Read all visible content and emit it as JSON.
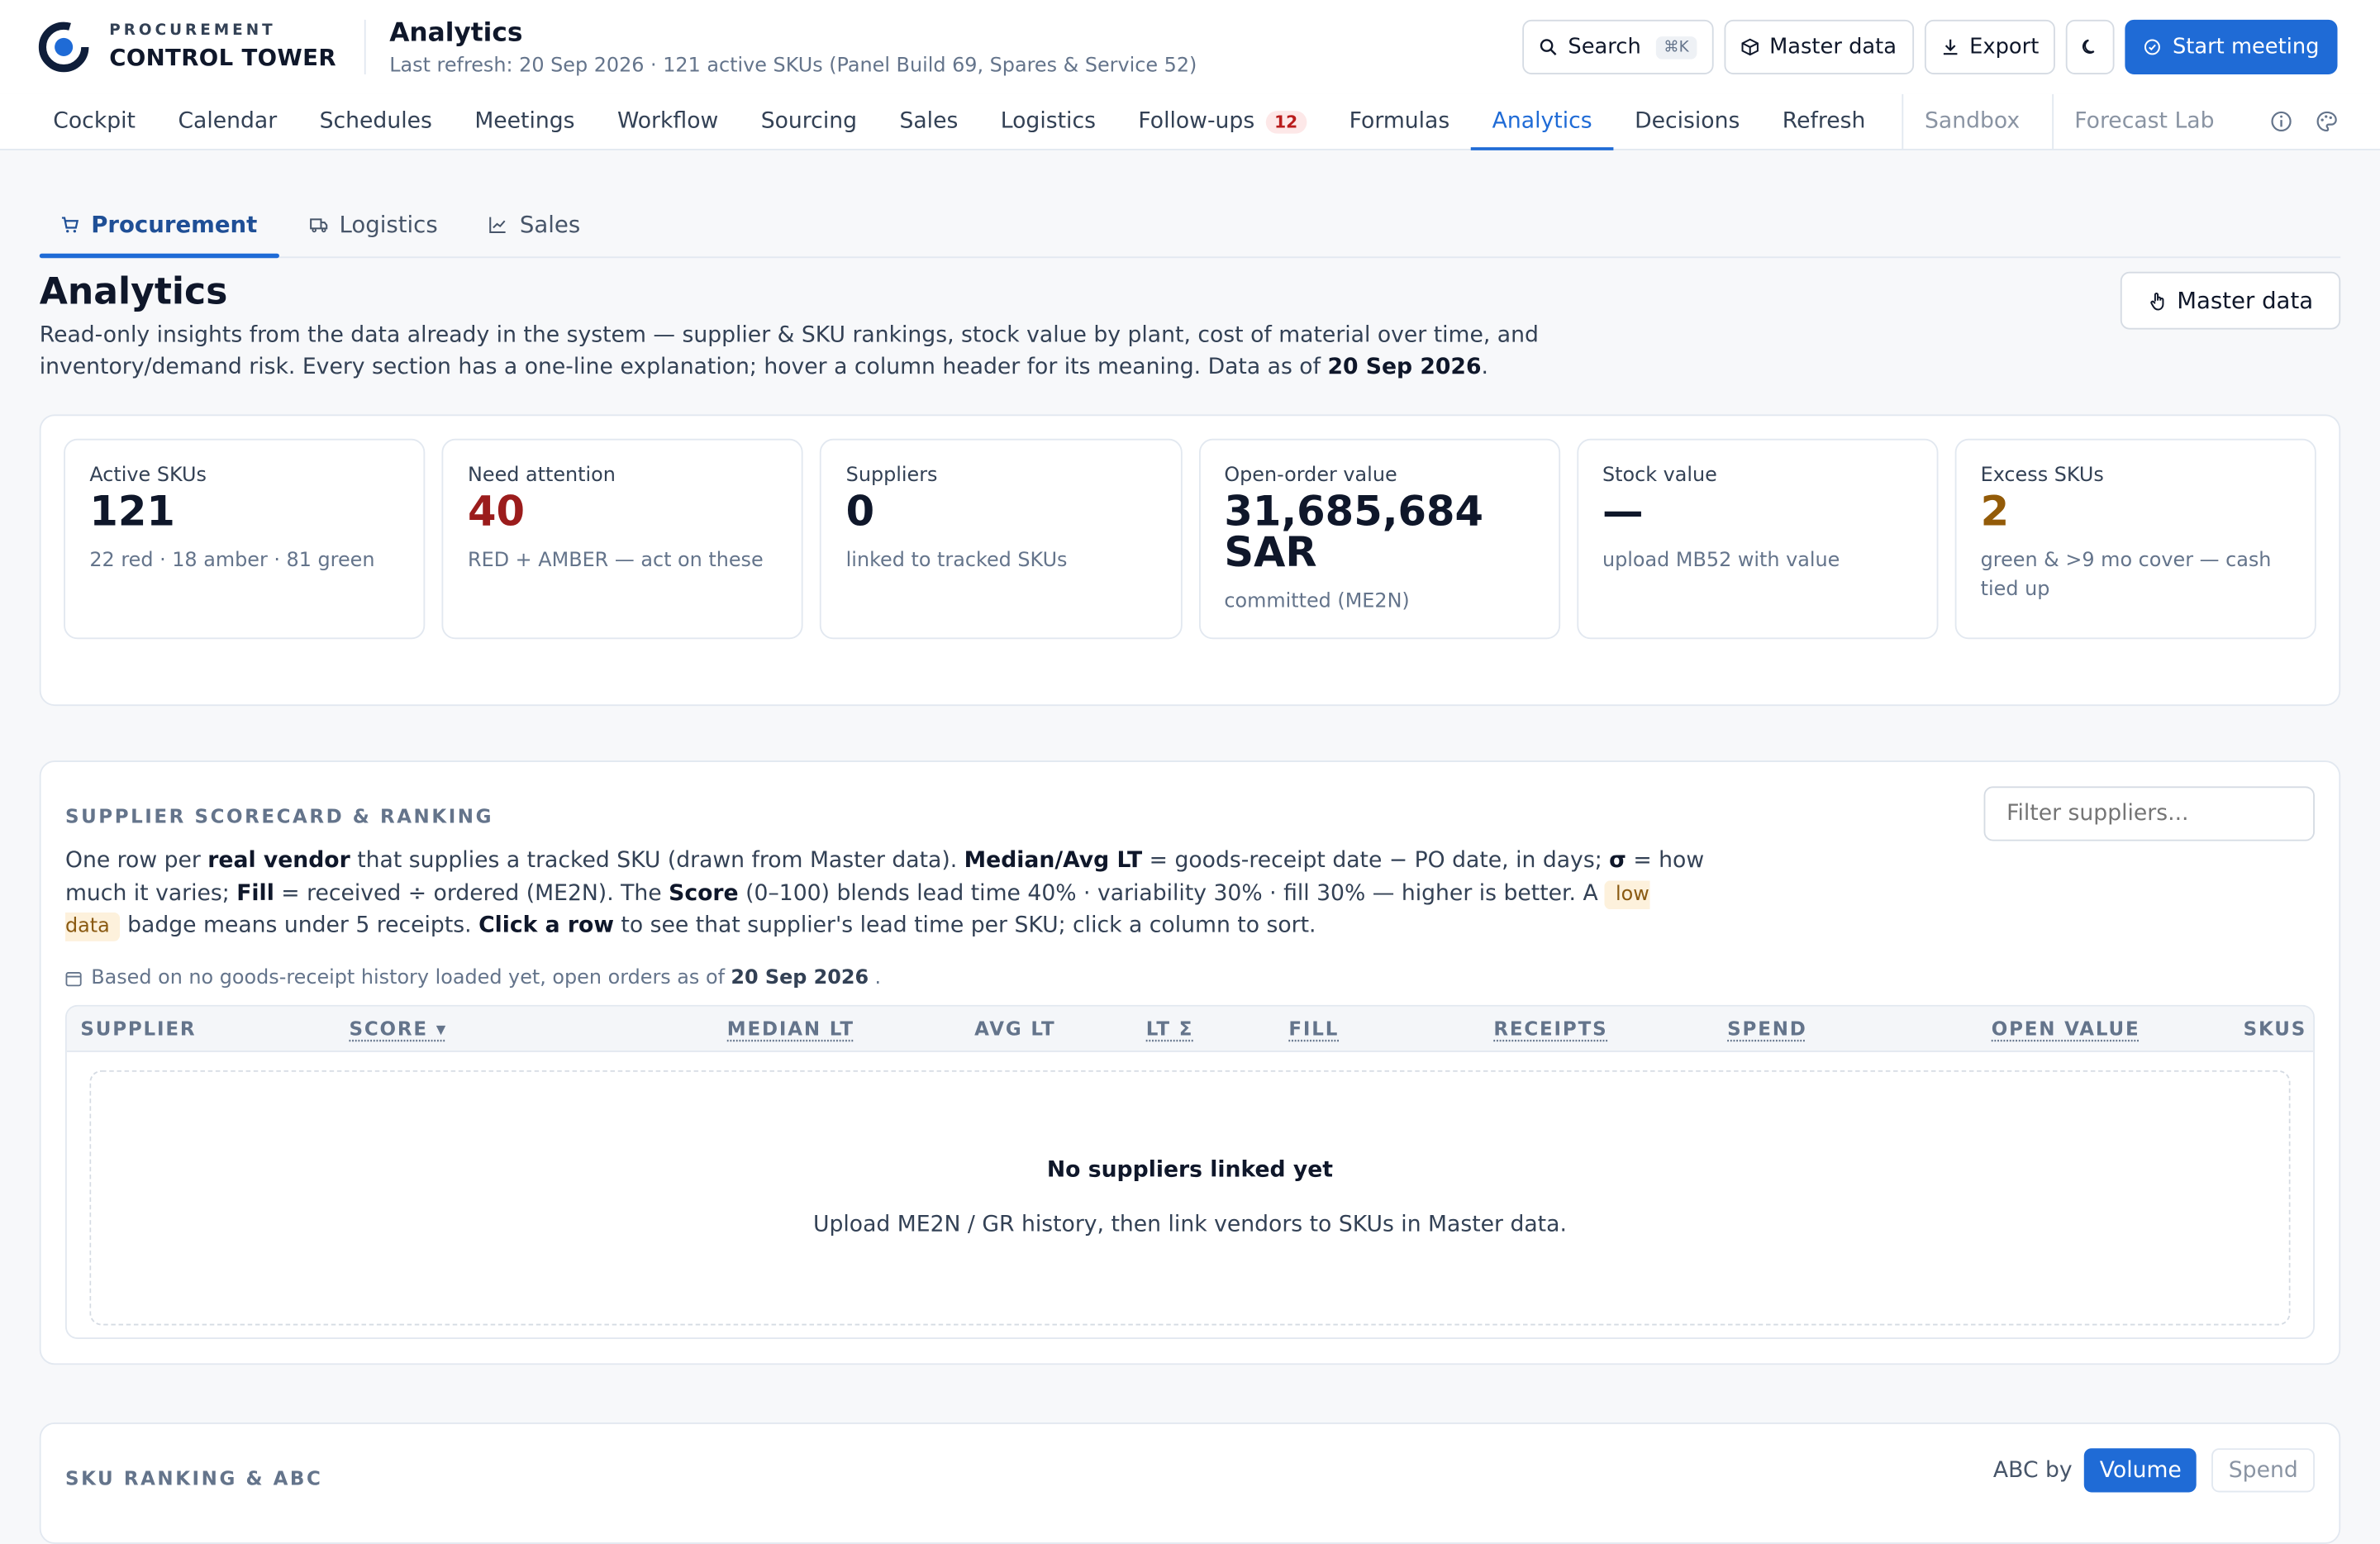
{
  "brand": {
    "small": "PROCUREMENT",
    "big": "CONTROL TOWER"
  },
  "header": {
    "title": "Analytics",
    "subtitle": "Last refresh: 20 Sep 2026 · 121 active SKUs (Panel Build 69, Spares & Service 52)",
    "search_label": "Search",
    "search_shortcut": "⌘K",
    "master_data_label": "Master data",
    "export_label": "Export",
    "start_meeting_label": "Start meeting"
  },
  "nav": {
    "items": [
      "Cockpit",
      "Calendar",
      "Schedules",
      "Meetings",
      "Workflow",
      "Sourcing",
      "Sales",
      "Logistics",
      "Follow-ups",
      "Formulas",
      "Analytics",
      "Decisions",
      "Refresh"
    ],
    "followups_count": "12",
    "active": "Analytics",
    "sandbox": "Sandbox",
    "forecast_lab": "Forecast Lab"
  },
  "subtabs": [
    "Procurement",
    "Logistics",
    "Sales"
  ],
  "analytics": {
    "title": "Analytics",
    "desc_part1": "Read-only insights from the data already in the system — supplier & SKU rankings, stock value by plant, cost of material over time, and inventory/demand risk. Every section has a one-line explanation; hover a column header for its meaning. Data as of ",
    "desc_date": "20 Sep 2026",
    "desc_end": ".",
    "master_data_label": "Master data"
  },
  "kpis": [
    {
      "label": "Active SKUs",
      "value": "121",
      "note": "22 red · 18 amber · 81 green"
    },
    {
      "label": "Need attention",
      "value": "40",
      "note": "RED + AMBER — act on these"
    },
    {
      "label": "Suppliers",
      "value": "0",
      "note": "linked to tracked SKUs"
    },
    {
      "label": "Open-order value",
      "value": "31,685,684 SAR",
      "note": "committed (ME2N)"
    },
    {
      "label": "Stock value",
      "value": "—",
      "note": "upload MB52 with value"
    },
    {
      "label": "Excess SKUs",
      "value": "2",
      "note": "green & >9 mo cover — cash tied up"
    }
  ],
  "scorecard": {
    "title": "SUPPLIER SCORECARD & RANKING",
    "filter_placeholder": "Filter suppliers...",
    "d1": "One row per ",
    "d2": "real vendor",
    "d3": " that supplies a tracked SKU (drawn from Master data). ",
    "d4": "Median/Avg LT",
    "d5": " = goods-receipt date − PO date, in days; ",
    "d6": "σ",
    "d7": " = how much it varies; ",
    "d8": "Fill",
    "d9": " = received ÷ ordered (ME2N). The ",
    "d10": "Score",
    "d11": " (0–100) blends lead time 40% · variability 30% · fill 30% — higher is better. A ",
    "d12": "low data",
    "d13": " badge means under 5 receipts. ",
    "d14": "Click a row",
    "d15": " to see that supplier's lead time per SKU; click a column to sort.",
    "basis_pre": "Based on no goods-receipt history loaded yet, open orders as of",
    "basis_date": "20 Sep 2026",
    "basis_post": ".",
    "columns": [
      "SUPPLIER",
      "SCORE ▾",
      "MEDIAN LT",
      "AVG LT",
      "LT Σ",
      "FILL",
      "RECEIPTS",
      "SPEND",
      "OPEN VALUE",
      "SKUS"
    ],
    "empty_title": "No suppliers linked yet",
    "empty_text": "Upload ME2N / GR history, then link vendors to SKUs in Master data."
  },
  "sku_ranking": {
    "title": "SKU RANKING & ABC",
    "abc_label": "ABC by",
    "volume": "Volume",
    "spend": "Spend"
  },
  "colors": {
    "accent": "#1f6bd6",
    "red": "#9b1c1c",
    "amber": "#935b08"
  }
}
